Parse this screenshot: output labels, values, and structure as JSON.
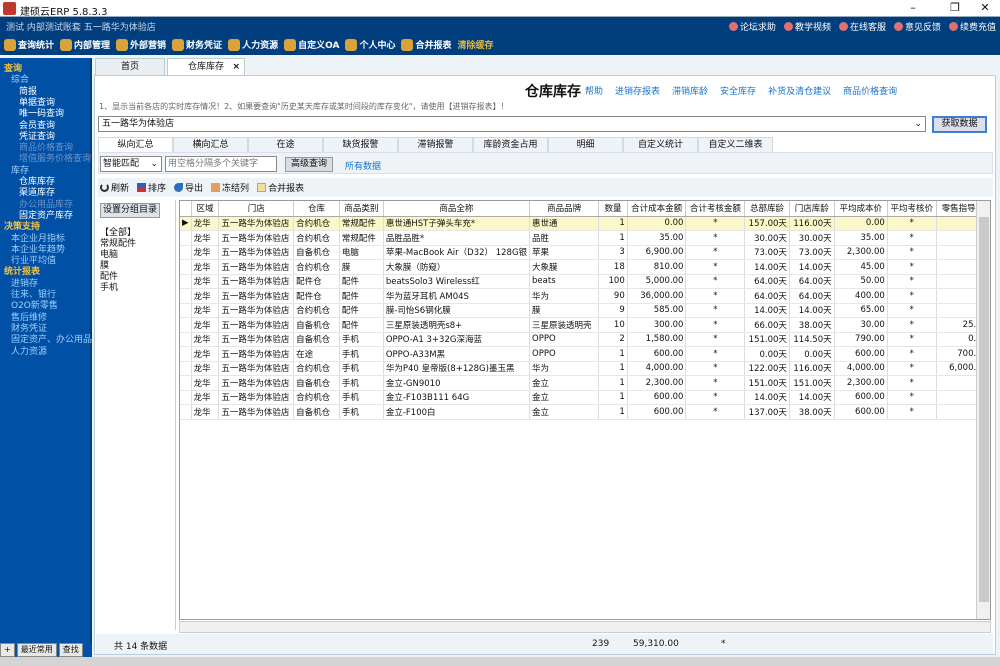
{
  "app": {
    "title": "建硕云ERP  5.8.3.3",
    "subtitle": "测试  内部测试账套   五一路华为体验店"
  },
  "nav": [
    "查询统计",
    "内部管理",
    "外部营销",
    "财务凭证",
    "人力资源",
    "自定义OA",
    "个人中心",
    "合并报表"
  ],
  "nav_clear": "清除缓存",
  "header_links": [
    "论坛求助",
    "教学视频",
    "在线客服",
    "意见反馈",
    "续费充值"
  ],
  "sidebar": [
    {
      "t": "查询",
      "k": "h"
    },
    {
      "t": "综合",
      "k": "l1"
    },
    {
      "t": "简报",
      "k": "l2"
    },
    {
      "t": "单据查询",
      "k": "l2"
    },
    {
      "t": "唯一码查询",
      "k": "l2"
    },
    {
      "t": "会员查询",
      "k": "l2"
    },
    {
      "t": "凭证查询",
      "k": "l2"
    },
    {
      "t": "商品价格查询",
      "k": "dis"
    },
    {
      "t": "增值服务价格查询",
      "k": "dis"
    },
    {
      "t": "库存",
      "k": "l1"
    },
    {
      "t": "仓库库存",
      "k": "l2"
    },
    {
      "t": "渠道库存",
      "k": "l2"
    },
    {
      "t": "办公用品库存",
      "k": "dis"
    },
    {
      "t": "固定资产库存",
      "k": "l2"
    },
    {
      "t": "决策支持",
      "k": "h"
    },
    {
      "t": "本企业月指标",
      "k": "l1"
    },
    {
      "t": "本企业年趋势",
      "k": "l1"
    },
    {
      "t": "行业平均值",
      "k": "l1"
    },
    {
      "t": "统计报表",
      "k": "h"
    },
    {
      "t": "进销存",
      "k": "l1"
    },
    {
      "t": "往来、银行",
      "k": "l1"
    },
    {
      "t": "O2O新零售",
      "k": "l1"
    },
    {
      "t": "售后维修",
      "k": "l1"
    },
    {
      "t": "财务凭证",
      "k": "l1"
    },
    {
      "t": "固定资产、办公用品",
      "k": "l1"
    },
    {
      "t": "人力资源",
      "k": "l1"
    }
  ],
  "sidebar_bottom": [
    "+",
    "最近常用",
    "查找"
  ],
  "page_tabs": {
    "home": "首页",
    "current": "仓库库存",
    "close": "×"
  },
  "page": {
    "title": "仓库库存",
    "links": [
      "帮助",
      "进销存报表",
      "滞销库龄",
      "安全库存",
      "补货及清仓建议",
      "商品价格查询"
    ],
    "hint": "1、显示当前各店的实时库存情况！2、如果要查询\"历史某天库存或某时间段的库存变化\"，请使用【进销存报表】！",
    "store": "五一路华为体验店",
    "get_data": "获取数据"
  },
  "sub_tabs": [
    "纵向汇总",
    "横向汇总",
    "在途",
    "缺货报警",
    "滞销报警",
    "库龄资金占用",
    "明细",
    "自定义统计",
    "自定义二维表"
  ],
  "filter": {
    "match": "智能匹配",
    "placeholder": "用空格分隔多个关键字",
    "advanced": "高级查询",
    "all": "所有数据"
  },
  "toolbar": [
    "刷新",
    "排序",
    "导出",
    "冻结列",
    "合并报表"
  ],
  "groups": {
    "button": "设置分组目录",
    "items": [
      "【全部】",
      "常规配件",
      "电脑",
      "膜",
      "配件",
      "手机"
    ]
  },
  "table": {
    "columns": [
      "区域",
      "门店",
      "仓库",
      "商品类别",
      "商品全称",
      "商品品牌",
      "数量",
      "合计成本金额",
      "合计考核金额",
      "总部库龄",
      "门店库龄",
      "平均成本价",
      "平均考核价",
      "零售指导价"
    ],
    "rows": [
      [
        "龙华",
        "五一路华为体验店",
        "合约机仓",
        "常规配件",
        "惠世通HST子弹头车充*",
        "惠世通",
        "1",
        "0.00",
        "*",
        "157.00天",
        "116.00天",
        "0.00",
        "*",
        ""
      ],
      [
        "龙华",
        "五一路华为体验店",
        "合约机仓",
        "常规配件",
        "品胜品胜*",
        "品胜",
        "1",
        "35.00",
        "*",
        "30.00天",
        "30.00天",
        "35.00",
        "*",
        ""
      ],
      [
        "龙华",
        "五一路华为体验店",
        "自备机仓",
        "电脑",
        "苹果-MacBook Air（D32） 128G银",
        "苹果",
        "3",
        "6,900.00",
        "*",
        "73.00天",
        "73.00天",
        "2,300.00",
        "*",
        ""
      ],
      [
        "龙华",
        "五一路华为体验店",
        "合约机仓",
        "膜",
        "大象膜（防窥）",
        "大象膜",
        "18",
        "810.00",
        "*",
        "14.00天",
        "14.00天",
        "45.00",
        "*",
        ""
      ],
      [
        "龙华",
        "五一路华为体验店",
        "配件仓",
        "配件",
        "beatsSolo3 Wireless红",
        "beats",
        "100",
        "5,000.00",
        "*",
        "64.00天",
        "64.00天",
        "50.00",
        "*",
        ""
      ],
      [
        "龙华",
        "五一路华为体验店",
        "配件仓",
        "配件",
        "华为蓝牙耳机 AM04S",
        "华为",
        "90",
        "36,000.00",
        "*",
        "64.00天",
        "64.00天",
        "400.00",
        "*",
        ""
      ],
      [
        "龙华",
        "五一路华为体验店",
        "合约机仓",
        "配件",
        "膜-司怡S6钢化膜",
        "膜",
        "9",
        "585.00",
        "*",
        "14.00天",
        "14.00天",
        "65.00",
        "*",
        ""
      ],
      [
        "龙华",
        "五一路华为体验店",
        "自备机仓",
        "配件",
        "三星原装透明壳s8+",
        "三星原装透明壳",
        "10",
        "300.00",
        "*",
        "66.00天",
        "38.00天",
        "30.00",
        "*",
        "25.00"
      ],
      [
        "龙华",
        "五一路华为体验店",
        "自备机仓",
        "手机",
        "OPPO-A1 3+32G深海蓝",
        "OPPO",
        "2",
        "1,580.00",
        "*",
        "151.00天",
        "114.50天",
        "790.00",
        "*",
        "0.00"
      ],
      [
        "龙华",
        "五一路华为体验店",
        "在途",
        "手机",
        "OPPO-A33M黑",
        "OPPO",
        "1",
        "600.00",
        "*",
        "0.00天",
        "0.00天",
        "600.00",
        "*",
        "700.00"
      ],
      [
        "龙华",
        "五一路华为体验店",
        "合约机仓",
        "手机",
        "华为P40 皇帝版(8+128G)墨玉黑",
        "华为",
        "1",
        "4,000.00",
        "*",
        "122.00天",
        "116.00天",
        "4,000.00",
        "*",
        "6,000.00"
      ],
      [
        "龙华",
        "五一路华为体验店",
        "自备机仓",
        "手机",
        "金立-GN9010",
        "金立",
        "1",
        "2,300.00",
        "*",
        "151.00天",
        "151.00天",
        "2,300.00",
        "*",
        ""
      ],
      [
        "龙华",
        "五一路华为体验店",
        "合约机仓",
        "手机",
        "金立-F103B111 64G",
        "金立",
        "1",
        "600.00",
        "*",
        "14.00天",
        "14.00天",
        "600.00",
        "*",
        ""
      ],
      [
        "龙华",
        "五一路华为体验店",
        "自备机仓",
        "手机",
        "金立-F100白",
        "金立",
        "1",
        "600.00",
        "*",
        "137.00天",
        "38.00天",
        "600.00",
        "*",
        ""
      ]
    ]
  },
  "footer": {
    "count": "共 14 条数据",
    "qty": "239",
    "cost": "59,310.00",
    "star": "*"
  }
}
